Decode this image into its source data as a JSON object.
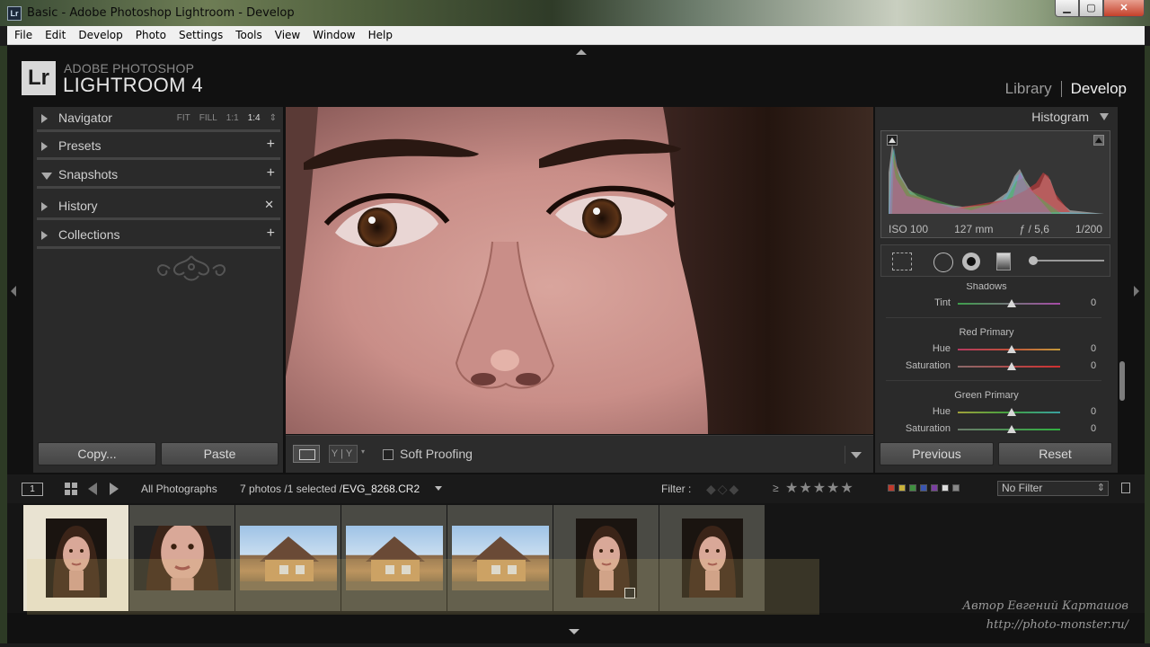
{
  "window": {
    "title": "Basic - Adobe Photoshop Lightroom - Develop",
    "app_icon": "Lr",
    "buttons": {
      "minimize": "▁",
      "maximize": "▢",
      "close": "✕"
    }
  },
  "menu": [
    "File",
    "Edit",
    "Develop",
    "Photo",
    "Settings",
    "Tools",
    "View",
    "Window",
    "Help"
  ],
  "identity": {
    "logo": "Lr",
    "line1": "ADOBE PHOTOSHOP",
    "line2": "LIGHTROOM 4",
    "modules": [
      {
        "label": "Library",
        "active": false
      },
      {
        "label": "Develop",
        "active": true
      }
    ]
  },
  "left_panel": {
    "navigator": {
      "label": "Navigator",
      "zoom_options": [
        "FIT",
        "FILL",
        "1:1",
        "1:4"
      ],
      "zoom_selected": "1:4",
      "zoom_arrows": "⇕"
    },
    "sections": [
      {
        "label": "Presets",
        "action": "+"
      },
      {
        "label": "Snapshots",
        "action": "+"
      },
      {
        "label": "History",
        "action": "✕"
      },
      {
        "label": "Collections",
        "action": "+"
      }
    ],
    "copy_label": "Copy...",
    "paste_label": "Paste"
  },
  "toolbar": {
    "before_after": "Y|Y",
    "dropdown_arrow": "▾",
    "soft_proofing_label": "Soft Proofing",
    "soft_proofing_checked": false
  },
  "right_panel": {
    "histogram_label": "Histogram",
    "histogram": {
      "iso": "ISO 100",
      "focal": "127 mm",
      "aperture": "ƒ / 5,6",
      "shutter": "1/200"
    },
    "adjust": [
      {
        "title": "Shadows",
        "rows": [
          {
            "name": "Tint",
            "value": "0"
          }
        ]
      },
      {
        "title": "Red Primary",
        "rows": [
          {
            "name": "Hue",
            "value": "0"
          },
          {
            "name": "Saturation",
            "value": "0"
          }
        ]
      },
      {
        "title": "Green Primary",
        "rows": [
          {
            "name": "Hue",
            "value": "0"
          },
          {
            "name": "Saturation",
            "value": "0"
          }
        ]
      }
    ],
    "previous_label": "Previous",
    "reset_label": "Reset"
  },
  "filmstrip_bar": {
    "secondary_window": "1",
    "source": "All Photographs",
    "count_prefix": "7 photos /1 selected /",
    "filename": "EVG_8268.CR2",
    "filter_label": "Filter :",
    "rating_op": "≥",
    "stars": "★★★★★",
    "color_labels": [
      "#c0392b",
      "#c9b23a",
      "#3f8f3f",
      "#3a55b0",
      "#7a3fa0",
      "#dddddd",
      "#888888"
    ],
    "no_filter": "No Filter"
  },
  "filmstrip": {
    "items": [
      {
        "kind": "portrait",
        "selected": true
      },
      {
        "kind": "portrait-wide",
        "selected": false
      },
      {
        "kind": "house",
        "selected": false
      },
      {
        "kind": "house",
        "selected": false
      },
      {
        "kind": "house",
        "selected": false
      },
      {
        "kind": "portrait",
        "selected": false,
        "badge": true
      },
      {
        "kind": "portrait",
        "selected": false
      }
    ]
  },
  "watermark": {
    "author_line1": "Автор Евгений Карташов",
    "author_line2": "http://photo-monster.ru/"
  }
}
